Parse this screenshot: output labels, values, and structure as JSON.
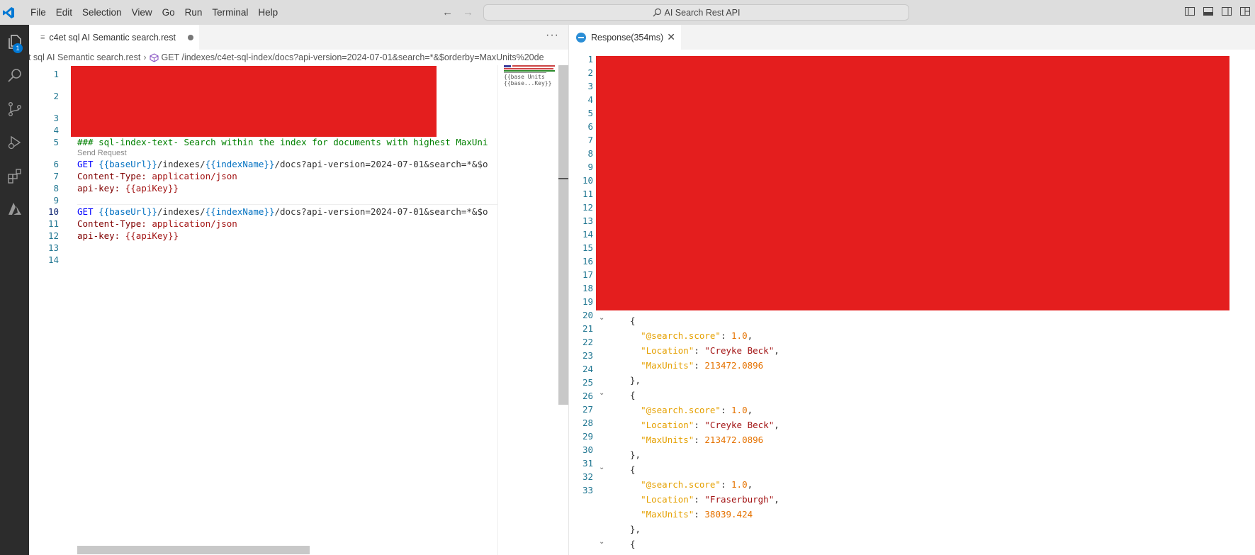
{
  "window": {
    "command_center": "AI Search Rest API"
  },
  "menu": [
    "File",
    "Edit",
    "Selection",
    "View",
    "Go",
    "Run",
    "Terminal",
    "Help"
  ],
  "activity": {
    "explorer_badge": "1"
  },
  "left_group": {
    "tab_title": "c4et sql AI Semantic search.rest",
    "breadcrumb_file": "et sql AI Semantic search.rest",
    "breadcrumb_symbol": "GET /indexes/c4et-sql-index/docs?api-version=2024-07-01&search=*&$orderby=MaxUnits%20de",
    "send_request": "Send Request",
    "lines": {
      "l5": "### sql-index-text- Search within the index for documents with highest MaxUni",
      "l6_method": "GET",
      "l6_rest": "/indexes/",
      "l6_tail": "/docs?api-version=2024-07-01&search=*&$o",
      "base_url": "{{baseUrl}}",
      "index_name": "{{indexName}}",
      "content_type_key": "Content-Type:",
      "content_type_val": "application/json",
      "api_key_key": "api-key:",
      "api_key_val": "{{apiKey}}"
    },
    "line_numbers": [
      "1",
      "2",
      "3",
      "4",
      "5",
      "6",
      "7",
      "8",
      "9",
      "10",
      "11",
      "12",
      "13",
      "14"
    ],
    "minimap_text": "{{base Units\n{{base...Key}}"
  },
  "right_group": {
    "tab_title": "Response(354ms)",
    "line_numbers": [
      "1",
      "2",
      "3",
      "4",
      "5",
      "6",
      "7",
      "8",
      "9",
      "10",
      "11",
      "12",
      "13",
      "14",
      "15",
      "16",
      "17",
      "18",
      "19",
      "20",
      "21",
      "22",
      "23",
      "24",
      "25",
      "26",
      "27",
      "28",
      "29",
      "30",
      "31",
      "32",
      "33"
    ],
    "json": {
      "score_key": "\"@search.score\"",
      "location_key": "\"Location\"",
      "maxunits_key": "\"MaxUnits\"",
      "records": [
        {
          "score": "1.0",
          "location": "\"Creyke Beck\"",
          "maxunits": "213472.0896"
        },
        {
          "score": "1.0",
          "location": "\"Creyke Beck\"",
          "maxunits": "213472.0896"
        },
        {
          "score": "1.0",
          "location": "\"Fraserburgh\"",
          "maxunits": "38039.424"
        }
      ]
    }
  },
  "colors": {
    "redaction": "#e41e1e",
    "activity_bar": "#2c2c2c",
    "accent": "#0078d4"
  }
}
